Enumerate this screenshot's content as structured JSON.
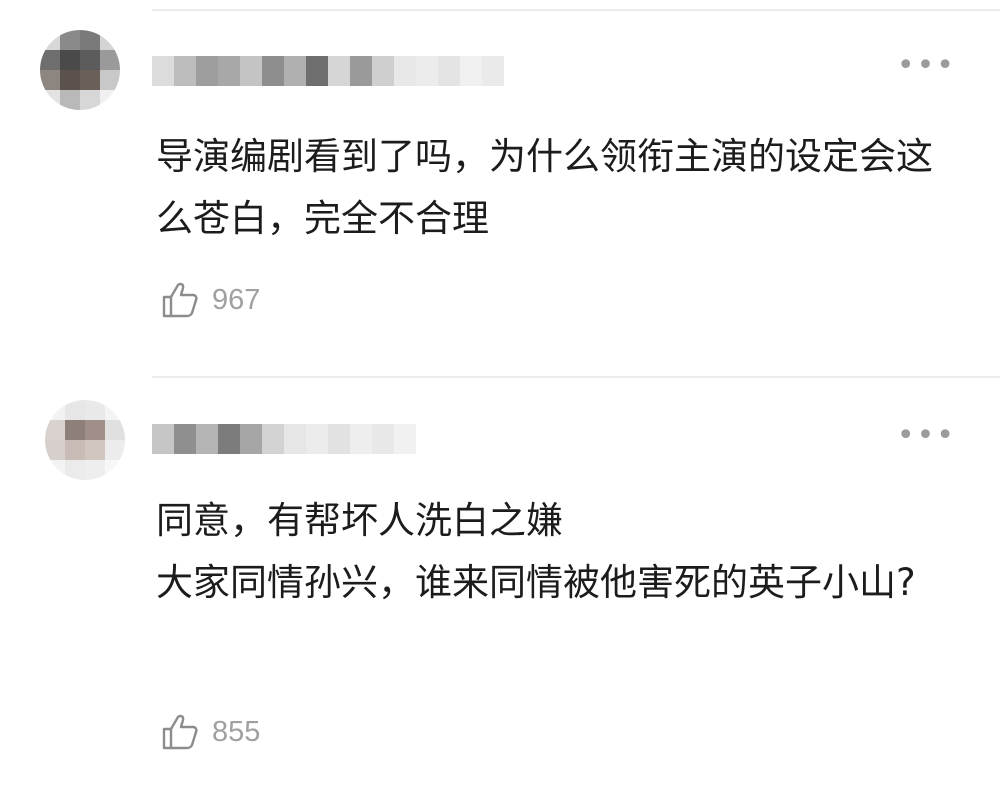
{
  "comments": [
    {
      "text": "导演编剧看到了吗，为什么领衔主演的设定会这么苍白，完全不合理",
      "likes": "967",
      "avatar_icon": "blurred-avatar-icon",
      "username_blurred": true
    },
    {
      "text": "同意，有帮坏人洗白之嫌\n大家同情孙兴，谁来同情被他害死的英子小山?",
      "likes": "855",
      "avatar_icon": "blurred-avatar-icon",
      "username_blurred": true
    }
  ],
  "icons": {
    "like": "thumbs-up-icon",
    "more": "more-options-icon"
  },
  "colors": {
    "text": "#1c1c1c",
    "muted": "#a0a0a0",
    "divider": "#ececec"
  }
}
